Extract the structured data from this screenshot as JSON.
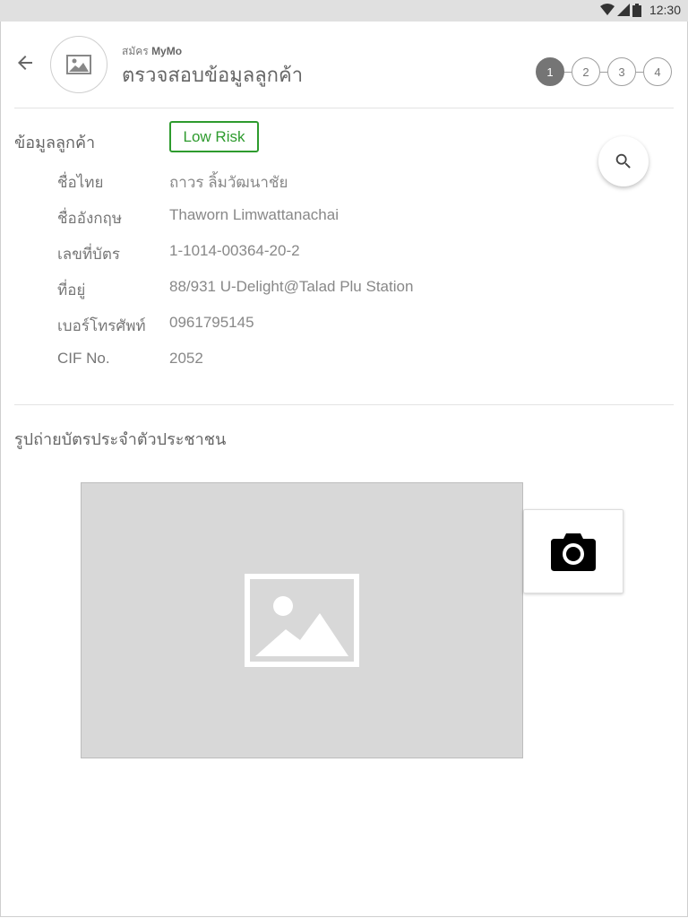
{
  "status_bar": {
    "time": "12:30"
  },
  "header": {
    "subtitle_prefix": "สมัคร",
    "subtitle_app": "MyMo",
    "title": "ตรวจสอบข้อมูลลูกค้า",
    "steps": [
      "1",
      "2",
      "3",
      "4"
    ],
    "active_step": 1
  },
  "customer": {
    "section_title": "ข้อมูลลูกค้า",
    "risk_badge": "Low Risk",
    "rows": [
      {
        "label": "ชื่อไทย",
        "value": "ถาวร ลิ้มวัฒนาชัย"
      },
      {
        "label": "ชื่ออังกฤษ",
        "value": "Thaworn Limwattanachai"
      },
      {
        "label": "เลขที่บัตร",
        "value": "1-1014-00364-20-2"
      },
      {
        "label": "ที่อยู่",
        "value": "88/931 U-Delight@Talad Plu Station"
      },
      {
        "label": "เบอร์โทรศัพท์",
        "value": "0961795145"
      },
      {
        "label": "CIF No.",
        "value": "2052"
      }
    ]
  },
  "id_photo": {
    "section_title": "รูปถ่ายบัตรประจำตัวประชาชน"
  },
  "icons": {
    "back": "arrow-left-icon",
    "avatar": "image-placeholder-icon",
    "search": "search-icon",
    "camera": "camera-icon",
    "photo": "image-placeholder-icon"
  },
  "colors": {
    "risk_green": "#2e9b2e",
    "active_step": "#757575"
  }
}
